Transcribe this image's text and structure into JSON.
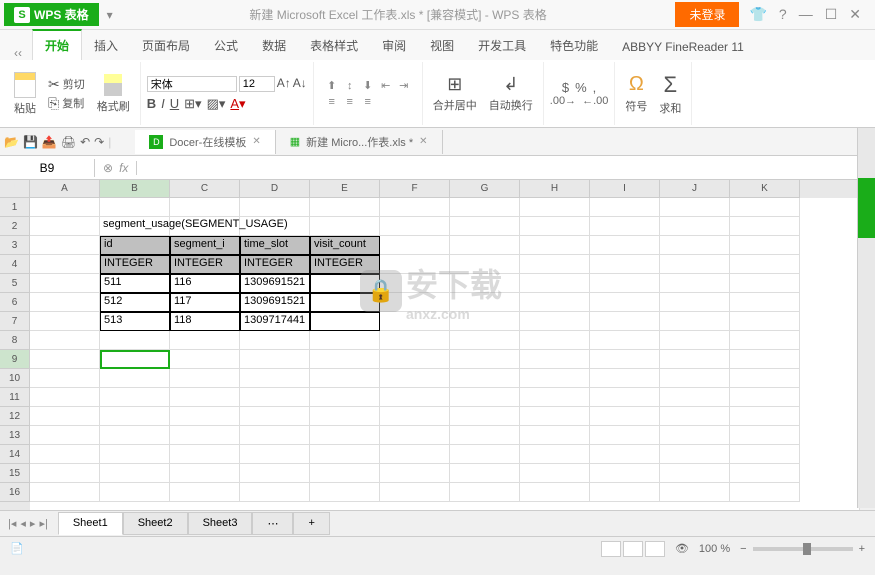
{
  "title": {
    "app_name": "WPS 表格",
    "doc_title": "新建 Microsoft Excel 工作表.xls * [兼容模式] - WPS 表格",
    "login_label": "未登录"
  },
  "menu": {
    "tabs": [
      "开始",
      "插入",
      "页面布局",
      "公式",
      "数据",
      "表格样式",
      "审阅",
      "视图",
      "开发工具",
      "特色功能",
      "ABBYY FineReader 11"
    ]
  },
  "ribbon": {
    "cut": "剪切",
    "copy": "复制",
    "paste": "粘贴",
    "format_painter": "格式刷",
    "font_name": "宋体",
    "font_size": "12",
    "merge": "合并居中",
    "wrap": "自动换行",
    "symbol": "符号",
    "sum": "求和"
  },
  "doc_tabs": {
    "docer": "Docer-在线模板",
    "file": "新建 Micro...作表.xls *"
  },
  "formula": {
    "cell_ref": "B9",
    "fx": "fx",
    "value": ""
  },
  "columns": [
    "A",
    "B",
    "C",
    "D",
    "E",
    "F",
    "G",
    "H",
    "I",
    "J",
    "K"
  ],
  "rows": [
    "1",
    "2",
    "3",
    "4",
    "5",
    "6",
    "7",
    "8",
    "9",
    "10",
    "11",
    "12",
    "13",
    "14",
    "15",
    "16"
  ],
  "active_cell": {
    "row": 9,
    "col": "B"
  },
  "table": {
    "title": "segment_usage(SEGMENT_USAGE)",
    "headers": [
      "id",
      "segment_i",
      "time_slot",
      "visit_count"
    ],
    "types": [
      "INTEGER",
      "INTEGER",
      "INTEGER",
      "INTEGER"
    ],
    "data": [
      [
        "511",
        "116",
        "1309691521",
        ""
      ],
      [
        "512",
        "117",
        "1309691521",
        ""
      ],
      [
        "513",
        "118",
        "1309717441",
        ""
      ]
    ]
  },
  "sheets": [
    "Sheet1",
    "Sheet2",
    "Sheet3"
  ],
  "status": {
    "zoom": "100 %"
  },
  "watermark": {
    "main": "安下载",
    "sub": "anxz.com"
  },
  "chart_data": {
    "type": "table",
    "title": "segment_usage(SEGMENT_USAGE)",
    "columns": [
      "id",
      "segment_id",
      "time_slot",
      "visit_count"
    ],
    "column_types": [
      "INTEGER",
      "INTEGER",
      "INTEGER",
      "INTEGER"
    ],
    "rows": [
      {
        "id": 511,
        "segment_id": 116,
        "time_slot": 1309691521,
        "visit_count": null
      },
      {
        "id": 512,
        "segment_id": 117,
        "time_slot": 1309691521,
        "visit_count": null
      },
      {
        "id": 513,
        "segment_id": 118,
        "time_slot": 1309717441,
        "visit_count": null
      }
    ]
  }
}
